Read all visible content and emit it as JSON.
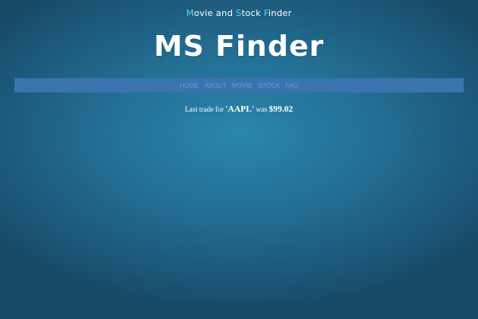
{
  "header": {
    "tagline_parts": [
      {
        "text": "M",
        "accent": true
      },
      {
        "text": "ovie and ",
        "accent": false
      },
      {
        "text": "S",
        "accent": true
      },
      {
        "text": "tock ",
        "accent": false
      },
      {
        "text": "F",
        "accent": true
      },
      {
        "text": "inder",
        "accent": false
      }
    ],
    "logo": "MS Finder"
  },
  "nav": {
    "items": [
      {
        "label": "HOME"
      },
      {
        "label": "ABOUT"
      },
      {
        "label": "MOVIE"
      },
      {
        "label": "STOCK"
      },
      {
        "label": "FAQ"
      }
    ]
  },
  "main": {
    "trade_prefix": "Last trade for ",
    "symbol": "'AAPL'",
    "trade_middle": " was ",
    "price": "$99.02"
  },
  "colors": {
    "accent": "#5fd3ff",
    "nav_bar": "#3a73ad",
    "nav_link": "#5fa0d6"
  }
}
